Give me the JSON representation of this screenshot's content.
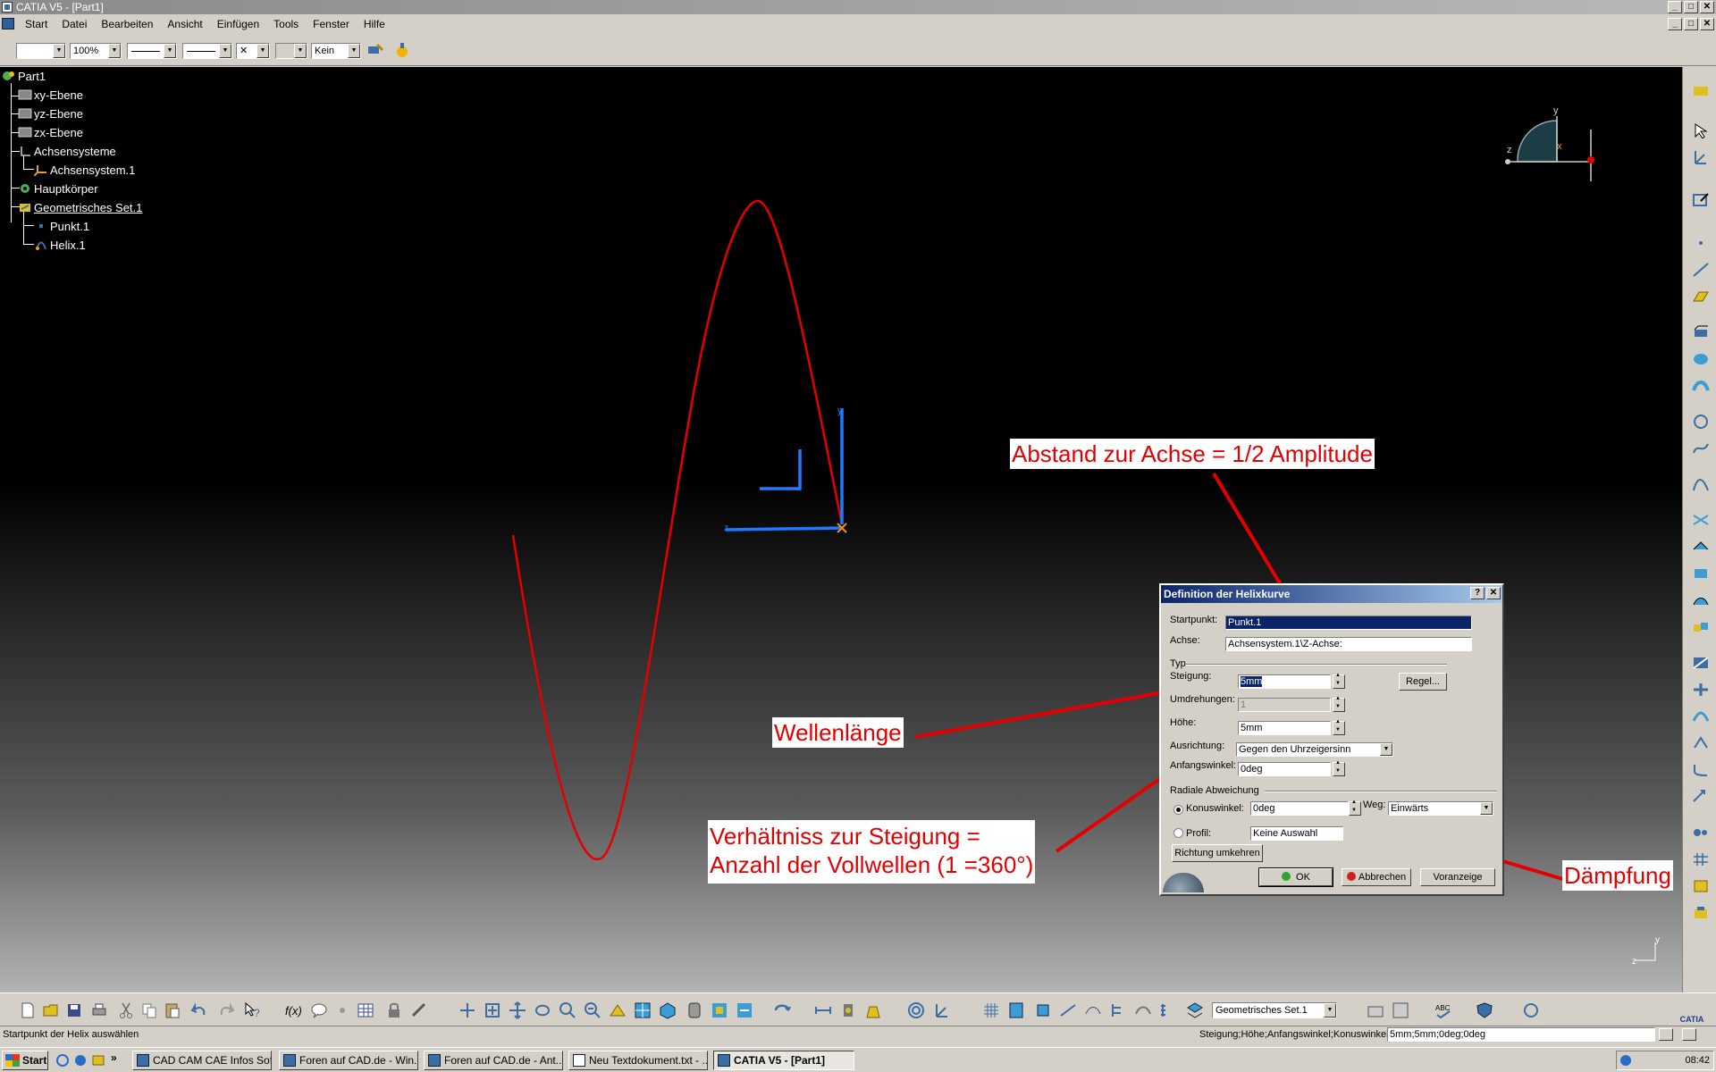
{
  "window": {
    "title": "CATIA V5 - [Part1]",
    "min": "_",
    "max": "□",
    "close": "✕"
  },
  "menu": {
    "items": [
      "Start",
      "Datei",
      "Bearbeiten",
      "Ansicht",
      "Einfügen",
      "Tools",
      "Fenster",
      "Hilfe"
    ]
  },
  "properties_toolbar": {
    "zoom": "100%",
    "layer": "Kein"
  },
  "tree": {
    "root": "Part1",
    "nodes": [
      "xy-Ebene",
      "yz-Ebene",
      "zx-Ebene",
      "Achsensysteme",
      "Achsensystem.1",
      "Hauptkörper",
      "Geometrisches Set.1",
      "Punkt.1",
      "Helix.1"
    ]
  },
  "compass": {
    "axis_y": "y",
    "axis_z": "z",
    "axis_x": "x"
  },
  "annotations": {
    "abstand": "Abstand zur Achse = 1/2 Amplitude",
    "wellenlaenge": "Wellenlänge",
    "verhaeltnis_1": "Verhältniss  zur Steigung =",
    "verhaeltnis_2": "Anzahl der Vollwellen (1 =360°)",
    "daempfung": "Dämpfung"
  },
  "dialog": {
    "title": "Definition der Helixkurve",
    "help": "?",
    "close": "✕",
    "startpunkt_label": "Startpunkt:",
    "startpunkt_value": "Punkt.1",
    "achse_label": "Achse:",
    "achse_value": "Achsensystem.1\\Z-Achse:",
    "typ_label": "Typ",
    "steigung_label": "Steigung:",
    "steigung_value": "5mm",
    "regel_button": "Regel...",
    "umdrehungen_label": "Umdrehungen:",
    "umdrehungen_value": "1",
    "hoehe_label": "Höhe:",
    "hoehe_value": "5mm",
    "ausrichtung_label": "Ausrichtung:",
    "ausrichtung_value": "Gegen den Uhrzeigersinn",
    "anfangswinkel_label": "Anfangswinkel:",
    "anfangswinkel_value": "0deg",
    "radiale_label": "Radiale Abweichung",
    "konuswinkel_label": "Konuswinkel:",
    "konuswinkel_value": "0deg",
    "weg_label": "Weg:",
    "weg_value": "Einwärts",
    "profil_label": "Profil:",
    "profil_value": "Keine Auswahl",
    "richtung_button": "Richtung umkehren",
    "ok_button": "OK",
    "abbrechen_button": "Abbrechen",
    "voranzeige_button": "Voranzeige"
  },
  "bottom_toolbar": {
    "set_combo": "Geometrisches Set.1",
    "abc": "ABC",
    "logo": "CATIA"
  },
  "status": {
    "prompt": "Startpunkt der Helix auswählen",
    "params_label": "Steigung;Höhe;Anfangswinkel;Konuswinkel",
    "params_value": "5mm;5mm;0deg;0deg"
  },
  "taskbar": {
    "start": "Start",
    "items": [
      "CAD CAM CAE Infos Soft...",
      "Foren auf CAD.de - Win...",
      "Foren auf CAD.de - Ant...",
      "Neu Textdokument.txt - ...",
      "CATIA V5 - [Part1]"
    ],
    "clock": "08:42",
    "quicklaunch_more": "»"
  },
  "colors": {
    "curve": "#e40000",
    "axis": "#1e7bff",
    "dialog_title": "#0a246a"
  }
}
